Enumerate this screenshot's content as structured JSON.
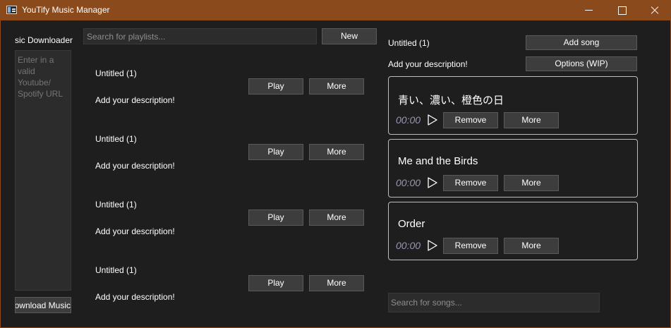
{
  "window": {
    "title": "YouTify Music Manager",
    "controls": {
      "minimize": "minimize-icon",
      "maximize": "maximize-icon",
      "close": "close-icon"
    },
    "accent": "#8a4a1c"
  },
  "downloader": {
    "header": "Music Downloader",
    "input_placeholder": "Enter in a valid Youtube/ Spotify URL",
    "button_label": "Download Music"
  },
  "playlists": {
    "search_placeholder": "Search for playlists...",
    "new_label": "New",
    "items": [
      {
        "title": "Untitled (1)",
        "description": "Add your description!",
        "play_label": "Play",
        "more_label": "More"
      },
      {
        "title": "Untitled (1)",
        "description": "Add your description!",
        "play_label": "Play",
        "more_label": "More"
      },
      {
        "title": "Untitled (1)",
        "description": "Add your description!",
        "play_label": "Play",
        "more_label": "More"
      },
      {
        "title": "Untitled (1)",
        "description": "Add your description!",
        "play_label": "Play",
        "more_label": "More"
      }
    ]
  },
  "selected_playlist": {
    "title": "Untitled (1)",
    "description": "Add your description!",
    "add_song_label": "Add song",
    "options_label": "Options (WIP)",
    "songs": [
      {
        "name": "青い、濃い、橙色の日",
        "time": "00:00",
        "remove_label": "Remove",
        "more_label": "More"
      },
      {
        "name": "Me and the Birds",
        "time": "00:00",
        "remove_label": "Remove",
        "more_label": "More"
      },
      {
        "name": "Order",
        "time": "00:00",
        "remove_label": "Remove",
        "more_label": "More"
      }
    ],
    "search_placeholder": "Search for songs..."
  }
}
